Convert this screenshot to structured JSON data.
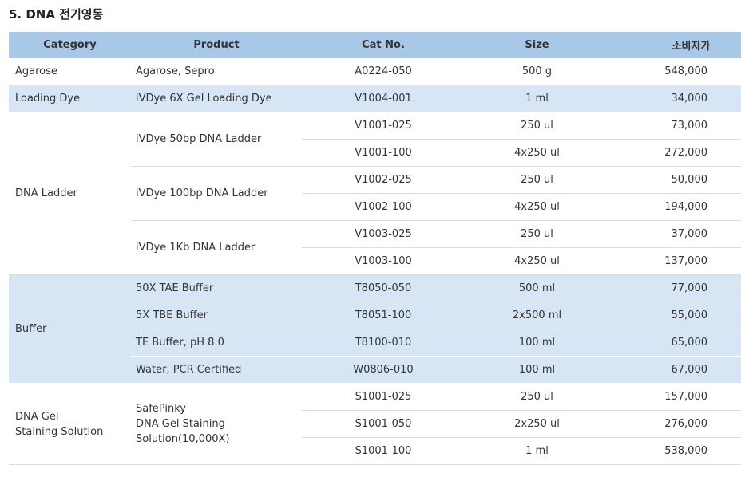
{
  "title": "5. DNA 전기영동",
  "headers": {
    "category": "Category",
    "product": "Product",
    "catno": "Cat No.",
    "size": "Size",
    "price": "소비자가"
  },
  "rows": [
    {
      "category": "Agarose",
      "product": "Agarose, Sepro",
      "catno": "A0224-050",
      "size": "500 g",
      "price": "548,000"
    },
    {
      "category": "Loading Dye",
      "product": "iVDye 6X Gel Loading Dye",
      "catno": "V1004-001",
      "size": "1 ml",
      "price": "34,000"
    },
    {
      "category": "DNA Ladder",
      "product": "iVDye 50bp DNA Ladder",
      "catno": "V1001-025",
      "size": "250 ul",
      "price": "73,000"
    },
    {
      "catno": "V1001-100",
      "size": "4x250 ul",
      "price": "272,000"
    },
    {
      "product": "iVDye 100bp DNA Ladder",
      "catno": "V1002-025",
      "size": "250 ul",
      "price": "50,000"
    },
    {
      "catno": "V1002-100",
      "size": "4x250 ul",
      "price": "194,000"
    },
    {
      "product": "iVDye 1Kb DNA Ladder",
      "catno": "V1003-025",
      "size": "250 ul",
      "price": "37,000"
    },
    {
      "catno": "V1003-100",
      "size": "4x250 ul",
      "price": "137,000"
    },
    {
      "category": "Buffer",
      "product": "50X TAE Buffer",
      "catno": "T8050-050",
      "size": "500 ml",
      "price": "77,000"
    },
    {
      "product": "5X TBE Buffer",
      "catno": "T8051-100",
      "size": "2x500 ml",
      "price": "55,000"
    },
    {
      "product": "TE Buffer, pH 8.0",
      "catno": "T8100-010",
      "size": "100 ml",
      "price": "65,000"
    },
    {
      "product": "Water, PCR Certified",
      "catno": "W0806-010",
      "size": "100 ml",
      "price": "67,000"
    },
    {
      "category_line1": "DNA Gel",
      "category_line2": "Staining Solution",
      "product_line1": "SafePinky",
      "product_line2": "DNA Gel Staining",
      "product_line3": "Solution(10,000X)",
      "catno": "S1001-025",
      "size": "250 ul",
      "price": "157,000"
    },
    {
      "catno": "S1001-050",
      "size": "2x250 ul",
      "price": "276,000"
    },
    {
      "catno": "S1001-100",
      "size": "1 ml",
      "price": "538,000"
    }
  ]
}
